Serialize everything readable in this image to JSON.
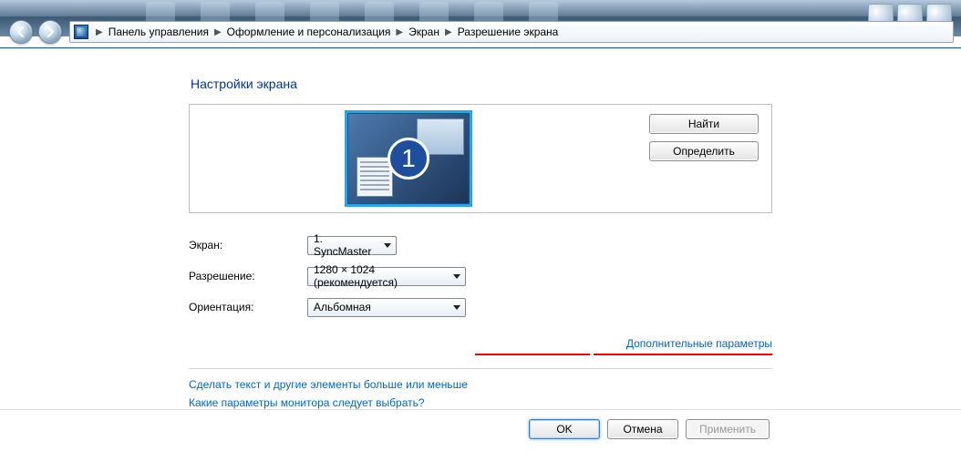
{
  "breadcrumb": {
    "items": [
      "Панель управления",
      "Оформление и персонализация",
      "Экран",
      "Разрешение экрана"
    ]
  },
  "title": "Настройки экрана",
  "preview": {
    "monitor_number": "1",
    "detect_label": "Найти",
    "identify_label": "Определить"
  },
  "form": {
    "display_label": "Экран:",
    "display_value": "1. SyncMaster",
    "resolution_label": "Разрешение:",
    "resolution_value": "1280 × 1024 (рекомендуется)",
    "orientation_label": "Ориентация:",
    "orientation_value": "Альбомная"
  },
  "advanced_link": "Дополнительные параметры",
  "helper_links": {
    "resize_text": "Сделать текст и другие элементы больше или меньше",
    "which_settings": "Какие параметры монитора следует выбрать?"
  },
  "footer": {
    "ok": "OK",
    "cancel": "Отмена",
    "apply": "Применить"
  }
}
